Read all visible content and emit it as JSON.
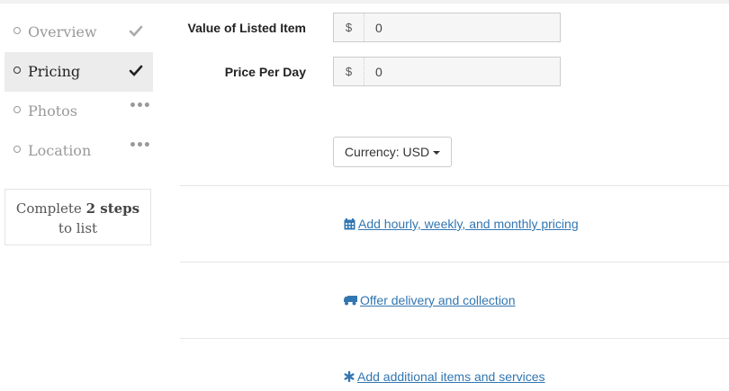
{
  "sidebar": {
    "items": [
      {
        "label": "Overview",
        "status_icon": "check-icon"
      },
      {
        "label": "Pricing",
        "status_icon": "check-icon",
        "active": true
      },
      {
        "label": "Photos",
        "status_icon": "ellipsis-icon",
        "status_text": "•••"
      },
      {
        "label": "Location",
        "status_icon": "ellipsis-icon",
        "status_text": "•••"
      }
    ],
    "steps": {
      "prefix": "Complete",
      "count": "2 steps",
      "suffix": "to list"
    }
  },
  "form": {
    "value_label": "Value of Listed Item",
    "value_prefix": "$",
    "value": "0",
    "price_label": "Price Per Day",
    "price_prefix": "$",
    "price": "0",
    "currency_label": "Currency: USD"
  },
  "links": {
    "pricing": "Add hourly, weekly, and monthly pricing",
    "delivery": "Offer delivery and collection",
    "extras": "Add additional items and services"
  },
  "colors": {
    "link": "#3276b1",
    "active_bg": "#ececec"
  }
}
